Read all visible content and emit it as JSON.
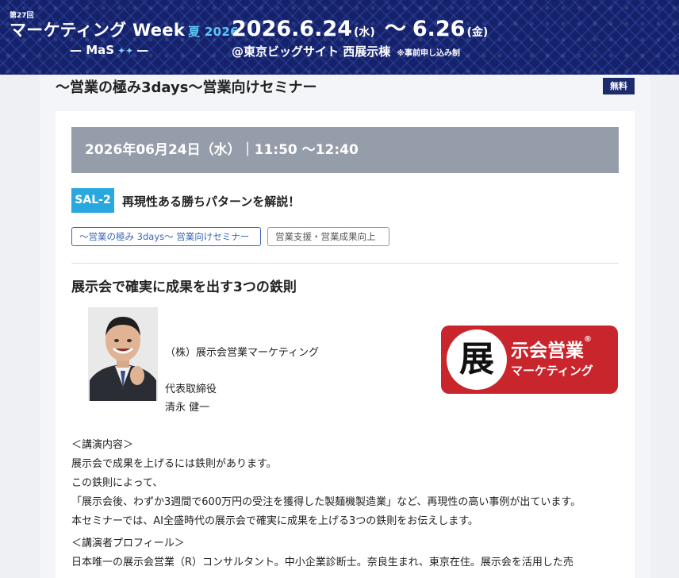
{
  "banner": {
    "edition": "第27回",
    "brand_name": "マーケティング Week",
    "season": "夏 2026",
    "sub_brand": "MaS",
    "date_start": "2026.6.24",
    "dow_start": "(水)",
    "tilde": "〜",
    "date_end": "6.26",
    "dow_end": "(金)",
    "venue": "@東京ビッグサイト 西展示棟",
    "registration_note": "※事前申し込み制"
  },
  "page": {
    "title": "〜営業の極み3days〜営業向けセミナー",
    "free_badge": "無料"
  },
  "session": {
    "datetime": "2026年06月24日（水）｜11:50 〜12:40",
    "code": "SAL-2",
    "title": "再現性ある勝ちパターンを解説！",
    "tags": [
      "〜営業の極み 3days〜 営業向けセミナー",
      "営業支援・営業成果向上"
    ],
    "talk_title": "展示会で確実に成果を出す3つの鉄則",
    "speaker": {
      "company": "（株）展示会営業マーケティング",
      "role": "代表取締役",
      "name": "清永 健一"
    },
    "logo": {
      "kanji": "展",
      "line1": "示会営業",
      "reg_mark": "®",
      "line2": "マーケティング"
    },
    "content_heading": "＜講演内容＞",
    "content": [
      "展示会で成果を上げるには鉄則があります。",
      "この鉄則によって、",
      "「展示会後、わずか3週間で600万円の受注を獲得した製麺機製造業」など、再現性の高い事例が出ています。",
      "本セミナーでは、AI全盛時代の展示会で確実に成果を上げる3つの鉄則をお伝えします。"
    ],
    "profile_heading": "＜講演者プロフィール＞",
    "profile": [
      "日本唯一の展示会営業（R）コンサルタント。中小企業診断士。奈良生まれ、東京在住。展示会を活用した売"
    ]
  },
  "colors": {
    "banner_bg": "#15226b",
    "accent_blue": "#29a8e0",
    "date_bar": "#959dab",
    "badge_navy": "#1c2a6e",
    "logo_red": "#c9252c"
  }
}
